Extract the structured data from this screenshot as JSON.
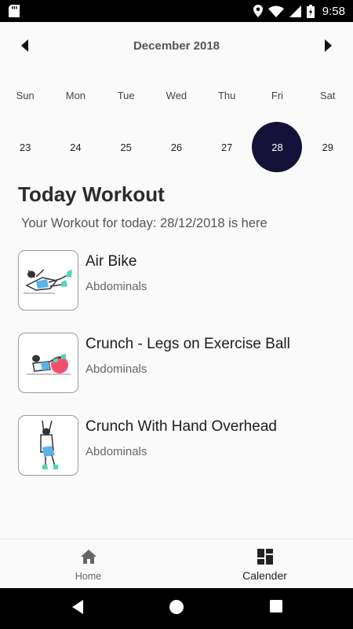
{
  "status_bar": {
    "time": "9:58",
    "icons": [
      "sd-card-icon",
      "location-icon",
      "wifi-icon",
      "signal-icon",
      "battery-icon"
    ]
  },
  "calendar": {
    "month_title": "December 2018",
    "weekdays": [
      "Sun",
      "Mon",
      "Tue",
      "Wed",
      "Thu",
      "Fri",
      "Sat"
    ],
    "dates": [
      "23",
      "24",
      "25",
      "26",
      "27",
      "28",
      "29"
    ],
    "selected_date": "28",
    "selected_color": "#15123a"
  },
  "workout": {
    "title": "Today Workout",
    "subtitle": "Your Workout for today: 28/12/2018 is here",
    "items": [
      {
        "name": "Air Bike",
        "category": "Abdominals"
      },
      {
        "name": "Crunch - Legs on Exercise Ball",
        "category": "Abdominals"
      },
      {
        "name": "Crunch With Hand Overhead",
        "category": "Abdominals"
      }
    ]
  },
  "bottom_nav": {
    "home_label": "Home",
    "calendar_label": "Calender",
    "active": "Calender"
  },
  "colors": {
    "accent": "#15123a",
    "exercise_accent": "#4dd9b8",
    "ball": "#f0506e",
    "shorts": "#5bb3e8"
  }
}
